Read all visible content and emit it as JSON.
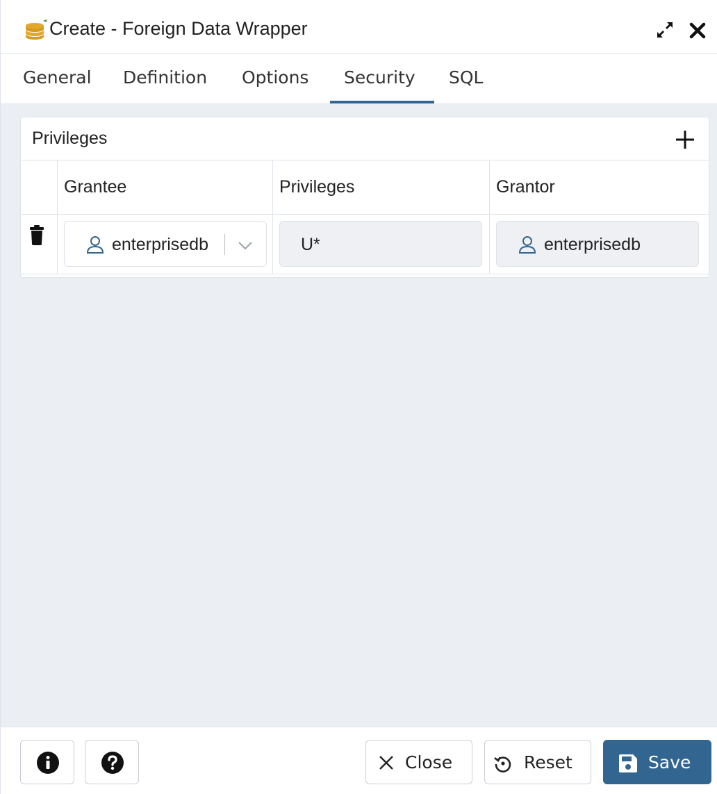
{
  "dialog": {
    "title": "Create - Foreign Data Wrapper",
    "icon": "database-stack-icon"
  },
  "tabs": [
    {
      "label": "General",
      "active": false
    },
    {
      "label": "Definition",
      "active": false
    },
    {
      "label": "Options",
      "active": false
    },
    {
      "label": "Security",
      "active": true
    },
    {
      "label": "SQL",
      "active": false
    }
  ],
  "privileges": {
    "title": "Privileges",
    "columns": [
      "Grantee",
      "Privileges",
      "Grantor"
    ],
    "rows": [
      {
        "grantee": "enterprisedb",
        "privileges": "U*",
        "grantor": "enterprisedb"
      }
    ]
  },
  "footer": {
    "close_label": "Close",
    "reset_label": "Reset",
    "save_label": "Save"
  },
  "colors": {
    "accent": "#326690",
    "title_icon": "#e1a82a",
    "user_icon": "#326690",
    "content_bg": "#ebeef3"
  }
}
